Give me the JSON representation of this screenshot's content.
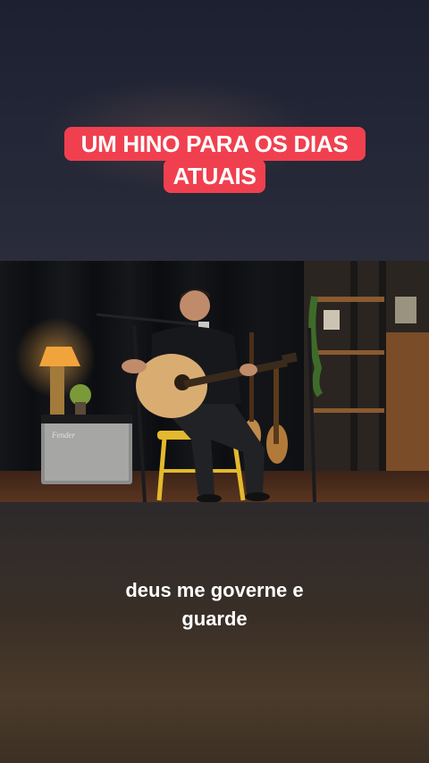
{
  "overlay": {
    "title_line1": "UM HINO PARA OS DIAS",
    "title_line2": "ATUAIS",
    "title_bg_color": "#f0404f"
  },
  "video": {
    "amp_brand": "Fender",
    "scene": "musician-with-acoustic-guitar-studio"
  },
  "caption": {
    "line1": "deus me governe e",
    "line2": "guarde"
  }
}
